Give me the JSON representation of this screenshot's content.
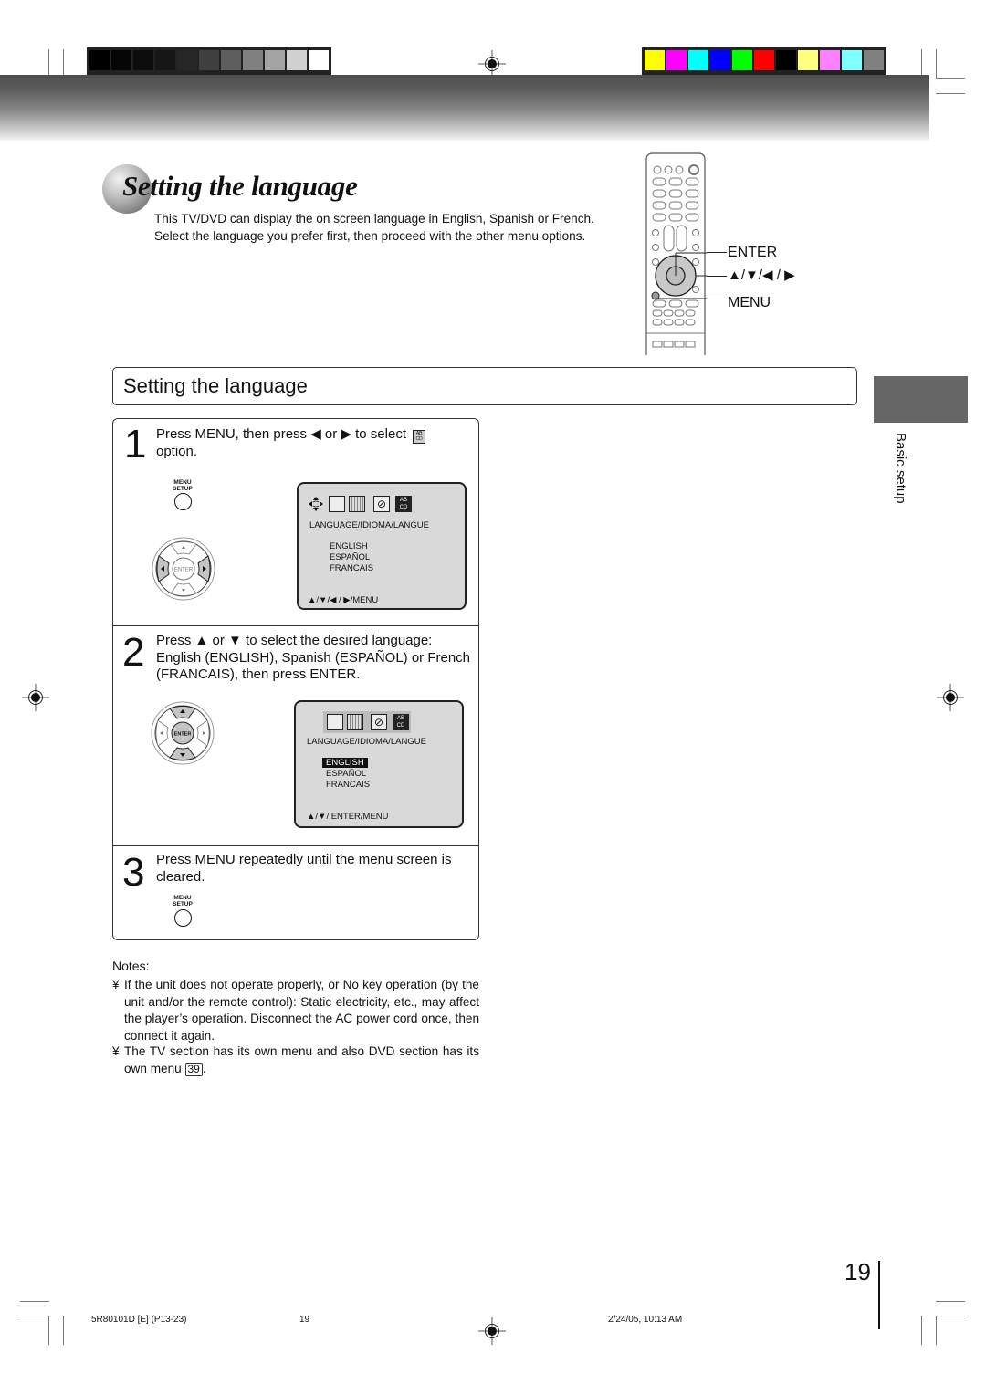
{
  "print_marks": {
    "grayscale_bar": [
      "#000000",
      "#050505",
      "#0c0c0c",
      "#161616",
      "#262626",
      "#404040",
      "#5e5e5e",
      "#808080",
      "#a4a4a4",
      "#d0d0d0",
      "#ffffff"
    ],
    "color_bar": [
      "#ffff00",
      "#ff00ff",
      "#00ffff",
      "#0000ff",
      "#00ff00",
      "#ff0000",
      "#000000",
      "#ffff80",
      "#ff80ff",
      "#80ffff",
      "#808080"
    ]
  },
  "header": {
    "title": "Setting the language",
    "intro": "This TV/DVD can display the on screen language in English, Spanish or French. Select the language you prefer first, then proceed with the other menu options."
  },
  "remote": {
    "labels": {
      "enter": "ENTER",
      "arrows": "▲/▼/◀ / ▶",
      "menu": "MENU"
    }
  },
  "section": {
    "title": "Setting the language"
  },
  "side_tab": {
    "label": "Basic setup"
  },
  "steps": [
    {
      "number": "1",
      "text": "Press MENU, then press ◀ or ▶ to select",
      "text_after_icon": "option.",
      "button_label_line1": "MENU",
      "button_label_line2": "SETUP",
      "dpad_center": "ENTER",
      "osd": {
        "heading": "LANGUAGE/IDIOMA/LANGUE",
        "options": [
          "ENGLISH",
          "ESPAÑOL",
          "FRANCAIS"
        ],
        "selected": null,
        "footer": "▲/▼/◀ / ▶/MENU",
        "active_tab_icon": "AB CD"
      }
    },
    {
      "number": "2",
      "text": "Press ▲ or ▼ to select the desired language: English (ENGLISH), Spanish (ESPAÑOL) or French (FRANCAIS), then press ENTER.",
      "dpad_center": "ENTER",
      "osd": {
        "heading": "LANGUAGE/IDIOMA/LANGUE",
        "options": [
          "ENGLISH",
          "ESPAÑOL",
          "FRANCAIS"
        ],
        "selected": "ENGLISH",
        "footer": "▲/▼/ ENTER/MENU",
        "active_tab_icon": "AB CD"
      }
    },
    {
      "number": "3",
      "text": "Press MENU repeatedly until the menu screen is cleared.",
      "button_label_line1": "MENU",
      "button_label_line2": "SETUP"
    }
  ],
  "notes": {
    "heading": "Notes:",
    "bullet": "¥",
    "items": [
      "If the unit does not operate properly, or No key operation (by the unit and/or the remote control): Static electricity, etc., may affect the player’s operation. Disconnect the AC power cord once, then connect it again.",
      "The TV section has its own menu and also DVD section has its own menu"
    ],
    "page_ref": "39",
    "page_ref_suffix": "."
  },
  "footer": {
    "page_number": "19",
    "doc_code": "5R80101D [E] (P13-23)",
    "doc_page": "19",
    "timestamp": "2/24/05, 10:13 AM"
  }
}
